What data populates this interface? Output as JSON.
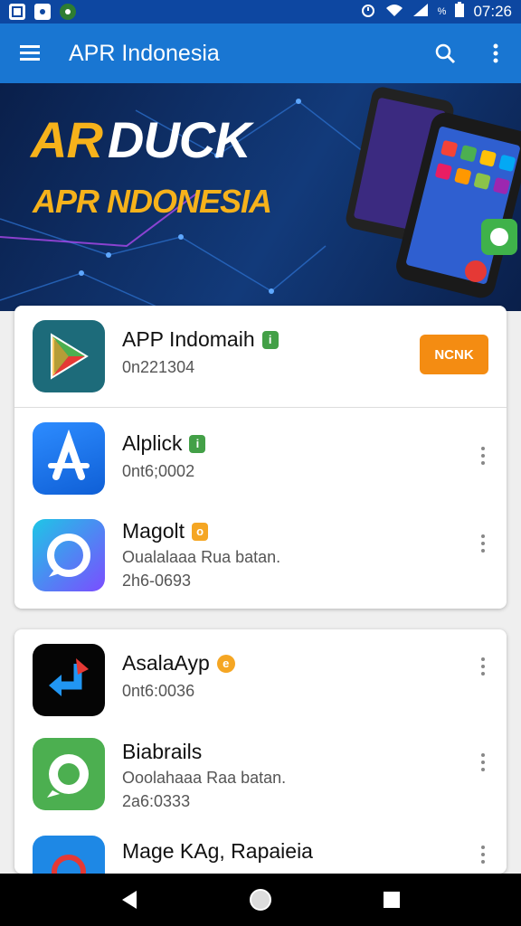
{
  "status_bar": {
    "time": "07:26",
    "battery_text": "%",
    "left_icons": [
      "image-icon",
      "message-icon",
      "green-dot-icon"
    ],
    "right_icons": [
      "alarm-icon",
      "wifi-icon",
      "signal-icon",
      "battery-icon"
    ]
  },
  "app_bar": {
    "title": "APR Indonesia",
    "icons": [
      "menu-icon",
      "search-icon",
      "more-vert-icon"
    ]
  },
  "banner": {
    "logo_text": "AR",
    "line1": "DUCK",
    "line2": "APR NDONESIA"
  },
  "colors": {
    "status_bar": "#0d47a1",
    "app_bar": "#1976d2",
    "banner_text": "#f6b21b",
    "install_button": "#f48c12",
    "badge_green": "#43a047",
    "badge_orange": "#f5a623"
  },
  "apps_group1": [
    {
      "name": "APP Indomaih",
      "line1": "0n221304",
      "line2": "",
      "badge": "green",
      "action": "NCNK"
    },
    {
      "name": "Alplick",
      "line1": "0nt6;0002",
      "line2": "",
      "badge": "green"
    },
    {
      "name": "Magolt",
      "line1": "Oualalaaa Rua batan.",
      "line2": "2h6-0693",
      "badge": "orange"
    }
  ],
  "apps_group2": [
    {
      "name": "AsalaAyp",
      "line1": "0nt6:0036",
      "line2": "",
      "badge": "orange-round"
    },
    {
      "name": "Biabrails",
      "line1": "Ooolahaaa Raa batan.",
      "line2": "2a6:0333",
      "badge": ""
    },
    {
      "name": "Mage KAg, Rapaieia",
      "line1": "",
      "line2": "",
      "badge": ""
    }
  ],
  "nav_bar": {
    "icons": [
      "back-icon",
      "home-icon",
      "recents-icon"
    ]
  }
}
